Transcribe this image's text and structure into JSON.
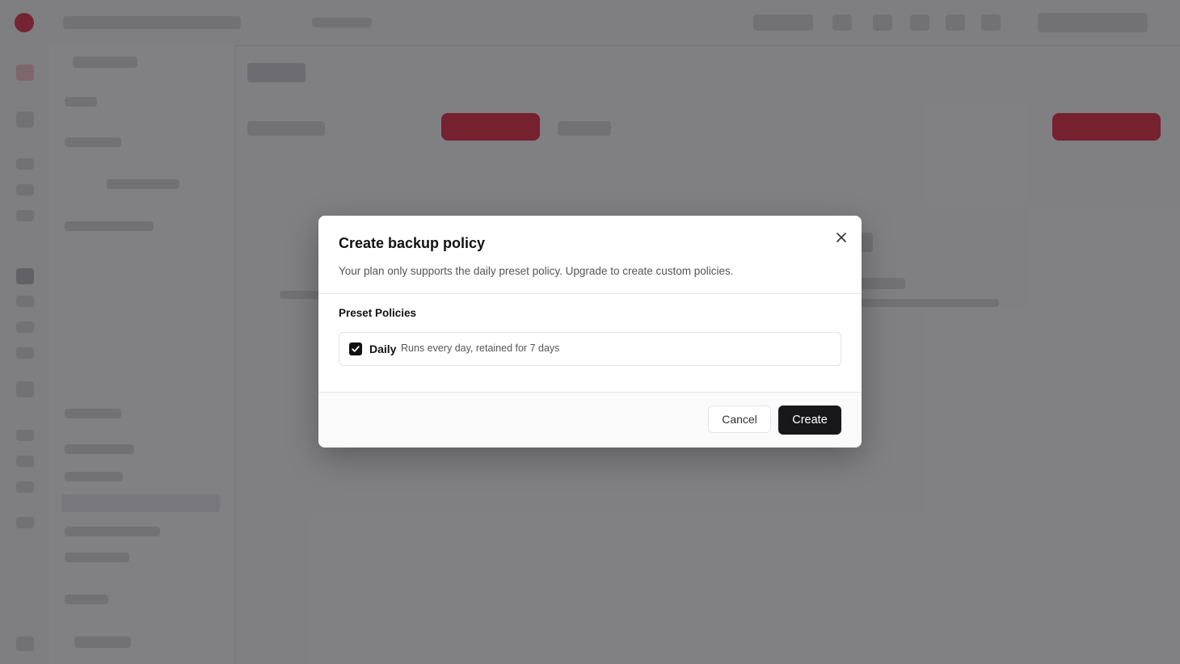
{
  "modal": {
    "title": "Create backup policy",
    "description": "Your plan only supports the daily preset policy. Upgrade to create custom policies.",
    "section_label": "Preset Policies",
    "option": {
      "name": "Daily",
      "description": "Runs every day, retained for 7 days",
      "checked": true
    },
    "cancel_label": "Cancel",
    "create_label": "Create",
    "close_icon": "close-icon",
    "checkbox_icon": "checkmark-icon"
  },
  "colors": {
    "primary_button": "#18181b",
    "accent": "#e2324f",
    "overlay": "rgba(20,18,22,0.52)"
  }
}
